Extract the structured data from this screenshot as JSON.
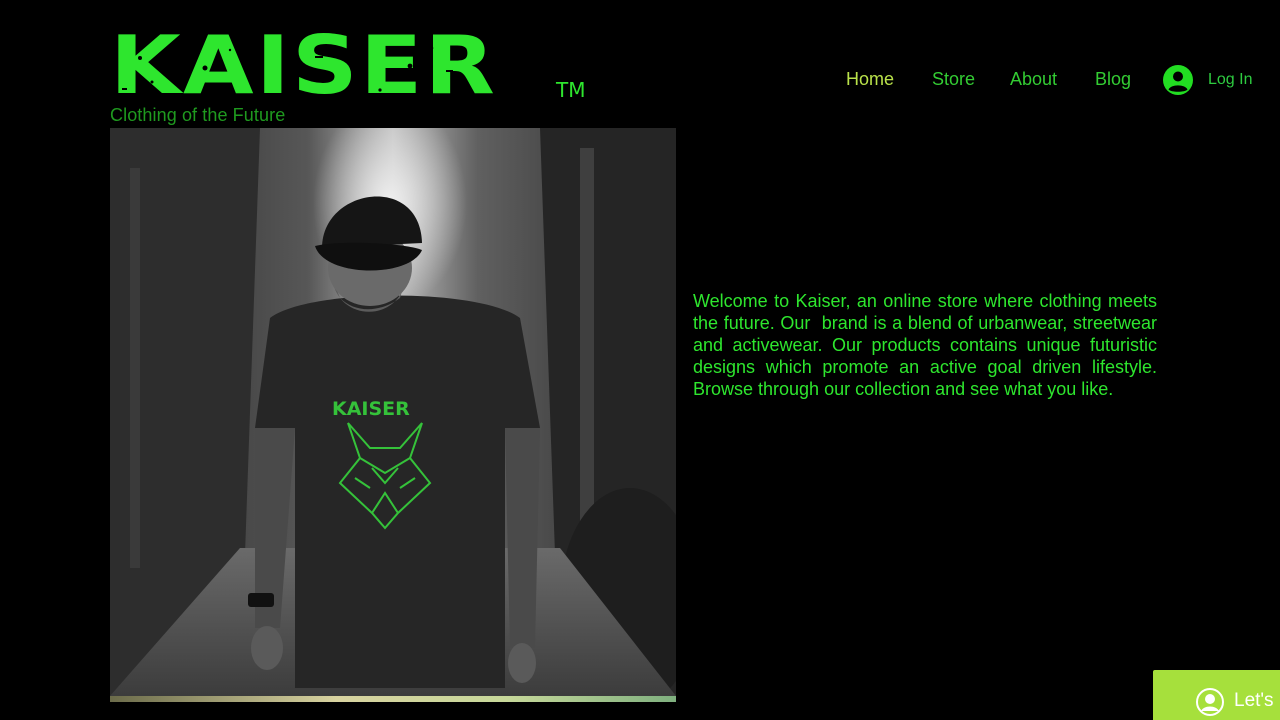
{
  "brand": {
    "logo_text": "KAISER",
    "trademark": "TM",
    "tagline": "Clothing of the Future",
    "color": "#2ee62e"
  },
  "nav": {
    "items": [
      {
        "label": "Home",
        "active": true
      },
      {
        "label": "Store",
        "active": false
      },
      {
        "label": "About",
        "active": false
      },
      {
        "label": "Blog",
        "active": false
      }
    ],
    "login_label": "Log In"
  },
  "hero": {
    "shirt_text": "KAISER",
    "icon": "lynx-head-emblem"
  },
  "welcome_text": "Welcome to Kaiser, an online store where clothing meets the future. Our  brand is a blend of urbanwear, streetwear and activewear. Our products contains unique futuristic designs which promote an active goal driven lifestyle. Browse through our collection and see what you like.",
  "chat": {
    "label": "Let's",
    "icon": "chat-avatar-icon",
    "color": "#a6e03c"
  },
  "colors": {
    "background": "#000000",
    "accent_green": "#2ee62e",
    "nav_active": "#b9e24a"
  }
}
